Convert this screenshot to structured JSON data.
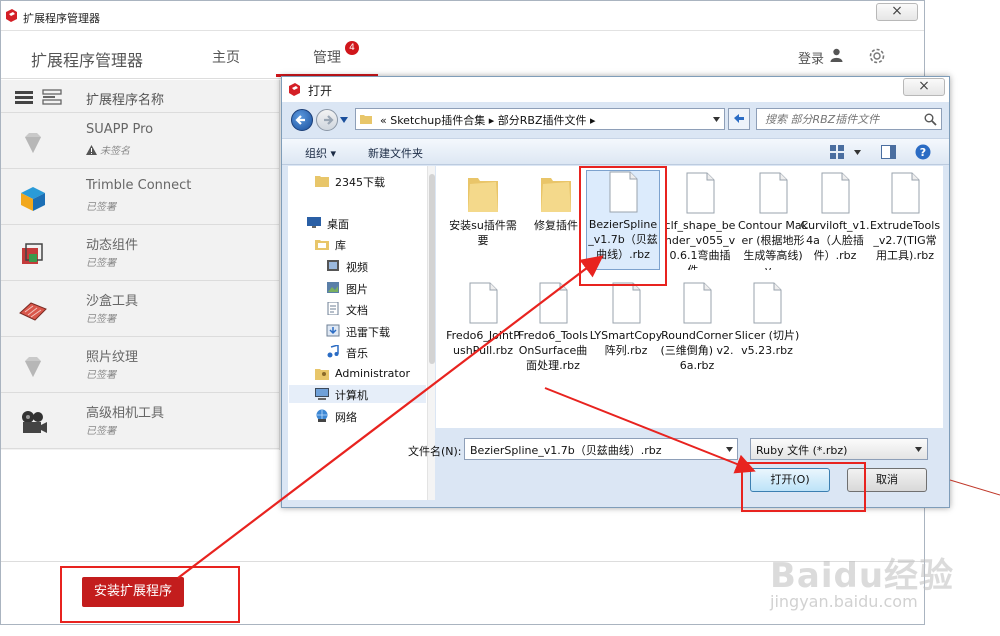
{
  "em": {
    "window_title": "扩展程序管理器",
    "brand": "扩展程序管理器",
    "tab_home": "主页",
    "tab_manage": "管理",
    "manage_badge": "4",
    "login": "登录",
    "column_title": "扩展程序名称",
    "extensions": [
      {
        "name": "SUAPP Pro",
        "status": "未签名",
        "icon": "gem-icon",
        "warn": true
      },
      {
        "name": "Trimble Connect",
        "status": "已签署",
        "icon": "trimble-connect-icon",
        "warn": false
      },
      {
        "name": "动态组件",
        "status": "已签署",
        "icon": "dynamic-components-icon",
        "warn": false
      },
      {
        "name": "沙盒工具",
        "status": "已签署",
        "icon": "sandbox-tools-icon",
        "warn": false
      },
      {
        "name": "照片纹理",
        "status": "已签署",
        "icon": "gem-icon",
        "warn": false
      },
      {
        "name": "高级相机工具",
        "status": "已签署",
        "icon": "camera-tools-icon",
        "warn": false
      }
    ],
    "install_button": "安装扩展程序"
  },
  "dialog": {
    "title": "打开",
    "address": "«  Sketchup插件合集  ▸  部分RBZ插件文件  ▸",
    "search_placeholder": "搜索 部分RBZ插件文件",
    "organize": "组织 ▾",
    "new_folder": "新建文件夹",
    "nav_items": [
      {
        "label": "2345下载",
        "icon": "folder-icon"
      },
      {
        "label": "桌面",
        "icon": "desktop-icon"
      },
      {
        "label": "库",
        "icon": "library-icon"
      },
      {
        "label": "视频",
        "icon": "video-icon"
      },
      {
        "label": "图片",
        "icon": "picture-icon"
      },
      {
        "label": "文档",
        "icon": "document-icon"
      },
      {
        "label": "迅雷下载",
        "icon": "download-icon"
      },
      {
        "label": "音乐",
        "icon": "music-icon"
      },
      {
        "label": "Administrator",
        "icon": "user-folder-icon"
      },
      {
        "label": "计算机",
        "icon": "computer-icon"
      },
      {
        "label": "网络",
        "icon": "network-icon"
      }
    ],
    "files": [
      {
        "name": "安装su插件需要",
        "type": "folder"
      },
      {
        "name": "修复插件",
        "type": "folder"
      },
      {
        "name": "BezierSpline_v1.7b（贝兹曲线）.rbz",
        "type": "file"
      },
      {
        "name": "clf_shape_bender_v055_v0.6.1弯曲插件....",
        "type": "file"
      },
      {
        "name": "Contour Maker (根据地形生成等高线) v...",
        "type": "file"
      },
      {
        "name": "Curviloft_v1.4a（人脸插件）.rbz",
        "type": "file"
      },
      {
        "name": "ExtrudeTools_v2.7(TIG常用工具).rbz",
        "type": "file"
      },
      {
        "name": "Fredo6_JointPushPull.rbz",
        "type": "file"
      },
      {
        "name": "Fredo6_ToolsOnSurface曲面处理.rbz",
        "type": "file"
      },
      {
        "name": "LYSmartCopy阵列.rbz",
        "type": "file"
      },
      {
        "name": "RoundCorner(三维倒角) v2.6a.rbz",
        "type": "file"
      },
      {
        "name": "Slicer (切片) v5.23.rbz",
        "type": "file"
      }
    ],
    "filename_label": "文件名(N):",
    "filename_value": "BezierSpline_v1.7b（贝兹曲线）.rbz",
    "filetype_value": "Ruby 文件 (*.rbz)",
    "open_button": "打开(O)",
    "cancel_button": "取消"
  },
  "watermark": {
    "logo": "Baidu经验",
    "url": "jingyan.baidu.com"
  },
  "colors": {
    "accent_red": "#c31d1d",
    "annotation_red": "#e8231f",
    "badge_red": "#d0161b"
  }
}
